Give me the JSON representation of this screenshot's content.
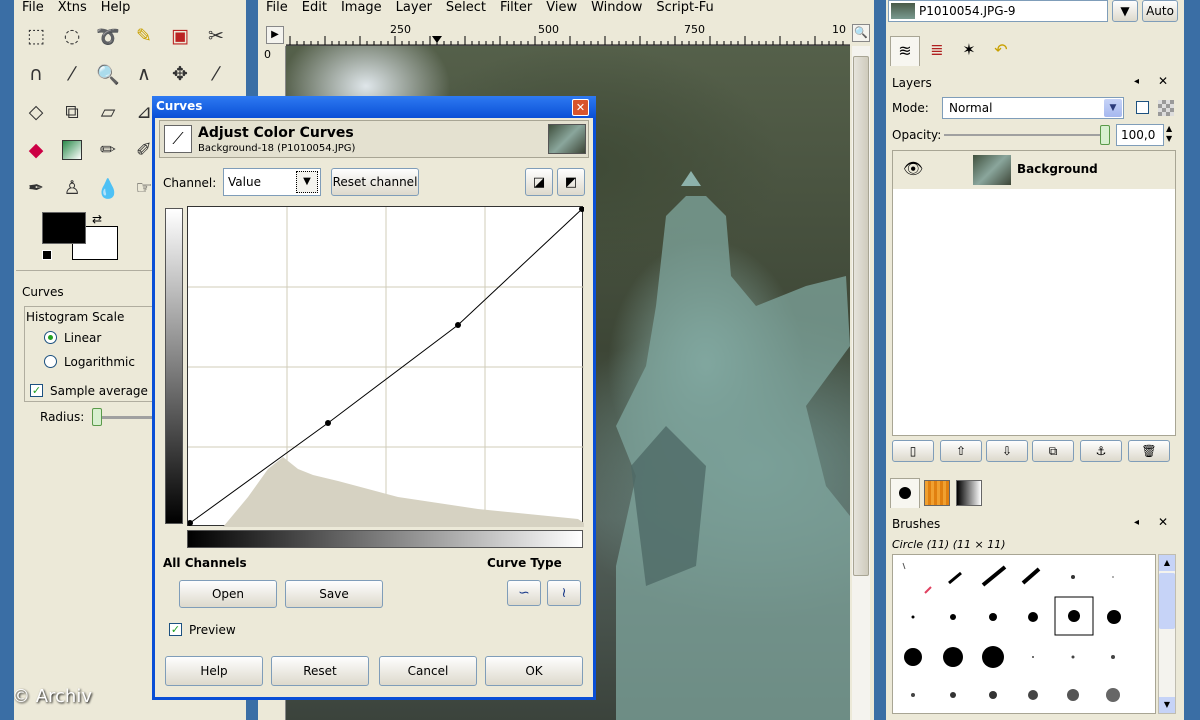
{
  "toolbox": {
    "menu": [
      "File",
      "Xtns",
      "Help"
    ],
    "curves_title": "Curves",
    "histogram_scale_label": "Histogram Scale",
    "linear_label": "Linear",
    "logarithmic_label": "Logarithmic",
    "sample_average_label": "Sample average",
    "radius_label": "Radius:"
  },
  "image_window": {
    "menu": [
      "File",
      "Edit",
      "Image",
      "Layer",
      "Select",
      "Filter",
      "View",
      "Window",
      "Script-Fu"
    ],
    "ruler": [
      "250",
      "500",
      "750",
      "10"
    ],
    "vruler_zero": "0"
  },
  "curves": {
    "title": "Curves",
    "heading": "Adjust Color Curves",
    "subheading": "Background-18 (P1010054.JPG)",
    "channel_label": "Channel:",
    "channel_value": "Value",
    "reset_channel": "Reset channel",
    "all_channels": "All Channels",
    "curve_type": "Curve Type",
    "open": "Open",
    "save": "Save",
    "preview": "Preview",
    "help": "Help",
    "reset": "Reset",
    "cancel": "Cancel",
    "ok": "OK"
  },
  "dock": {
    "image_select": "P1010054.JPG-9",
    "auto": "Auto",
    "layers_title": "Layers",
    "mode_label": "Mode:",
    "mode_value": "Normal",
    "opacity_label": "Opacity:",
    "opacity_value": "100,0",
    "layer_name": "Background",
    "brushes_title": "Brushes",
    "brush_info": "Circle (11) (11 × 11)"
  },
  "watermark": "© Archiv",
  "colors": {
    "selection_blue": "#3169c6",
    "xp_title": "#0a4fd6",
    "panel": "#ece9d8"
  }
}
